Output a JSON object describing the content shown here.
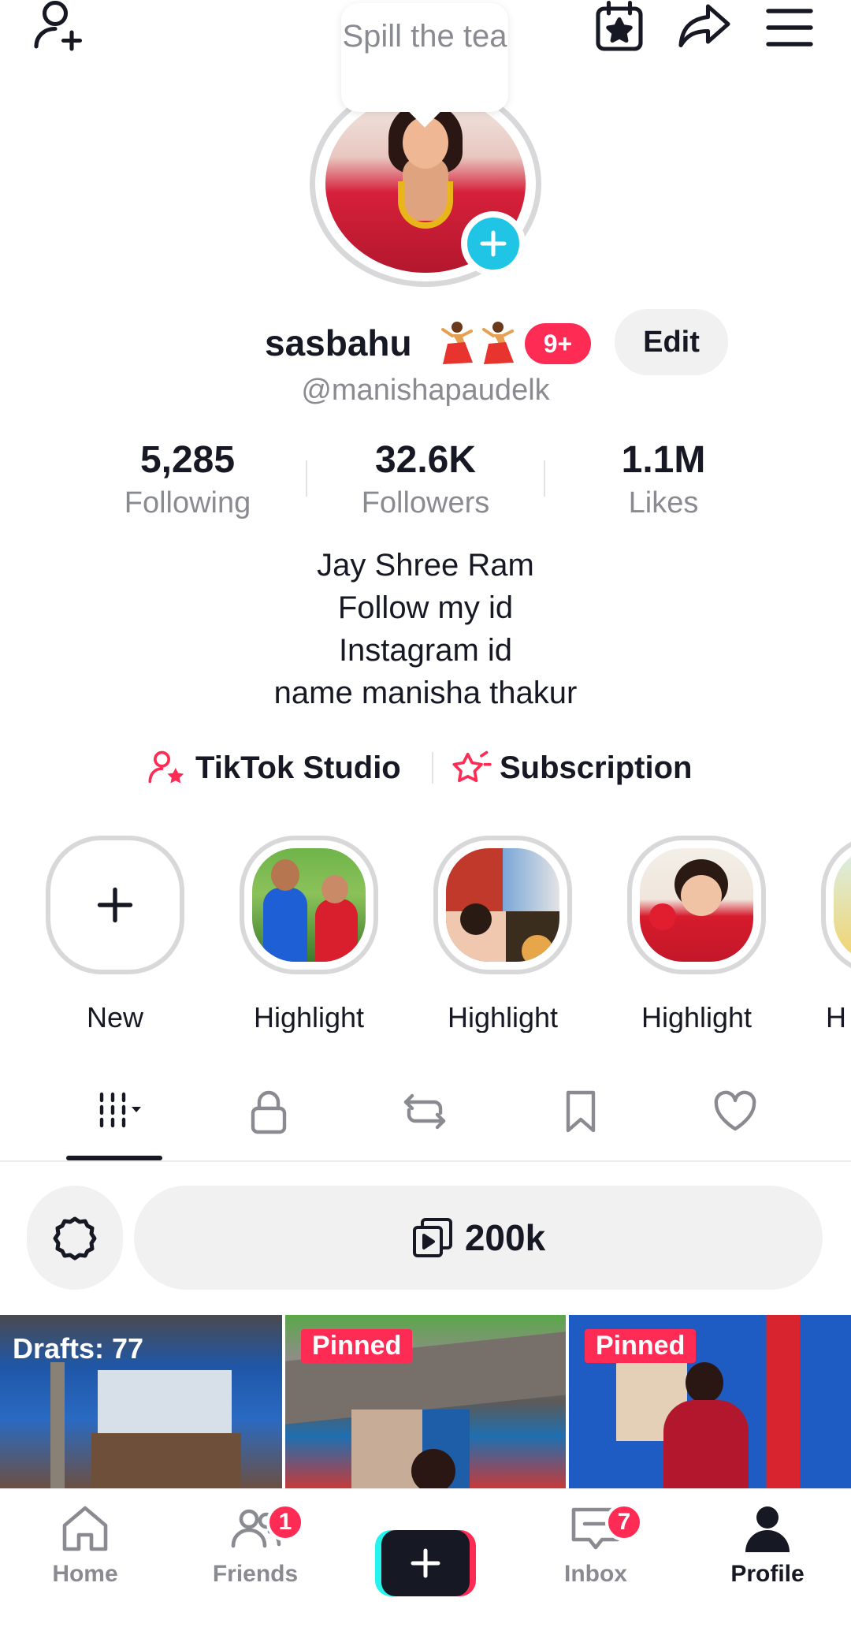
{
  "top_bar": {
    "icons": [
      "add-friend-icon",
      "calendar-star-icon",
      "share-icon",
      "menu-icon"
    ]
  },
  "note_bubble": {
    "text": "Spill the tea"
  },
  "profile": {
    "username": "sasbahu",
    "name_emoji": "dancer-emoji",
    "notification_badge": "9+",
    "edit_label": "Edit",
    "handle": "@manishapaudelk"
  },
  "stats": [
    {
      "value": "5,285",
      "label": "Following"
    },
    {
      "value": "32.6K",
      "label": "Followers"
    },
    {
      "value": "1.1M",
      "label": "Likes"
    }
  ],
  "bio": {
    "lines": [
      "Jay Shree Ram",
      "Follow my id",
      "Instagram id",
      "name manisha thakur"
    ]
  },
  "links": {
    "studio": "TikTok Studio",
    "subscription": "Subscription"
  },
  "highlights": {
    "new_label": "New",
    "items": [
      {
        "label": "Highlight"
      },
      {
        "label": "Highlight"
      },
      {
        "label": "Highlight"
      },
      {
        "label": "H"
      }
    ]
  },
  "tabs": {
    "items": [
      "videos-grid-icon",
      "lock-icon",
      "repost-icon",
      "bookmark-icon",
      "heart-icon"
    ],
    "active": "videos-grid-icon"
  },
  "filter": {
    "count_label": "200k"
  },
  "grid": {
    "cells": [
      {
        "label": "Drafts: 77",
        "type": "drafts"
      },
      {
        "label": "Pinned",
        "type": "pinned"
      },
      {
        "label": "Pinned",
        "type": "pinned"
      }
    ]
  },
  "bottom_nav": {
    "items": [
      {
        "label": "Home",
        "icon": "home-icon"
      },
      {
        "label": "Friends",
        "icon": "friends-icon",
        "badge": "1"
      },
      {
        "label": "",
        "icon": "create-icon"
      },
      {
        "label": "Inbox",
        "icon": "inbox-icon",
        "badge": "7"
      },
      {
        "label": "Profile",
        "icon": "profile-icon",
        "active": true
      }
    ]
  },
  "colors": {
    "accent_red": "#fe2c55",
    "accent_cyan": "#25f4ee",
    "text_primary": "#161823",
    "text_secondary": "#8a8b91"
  }
}
